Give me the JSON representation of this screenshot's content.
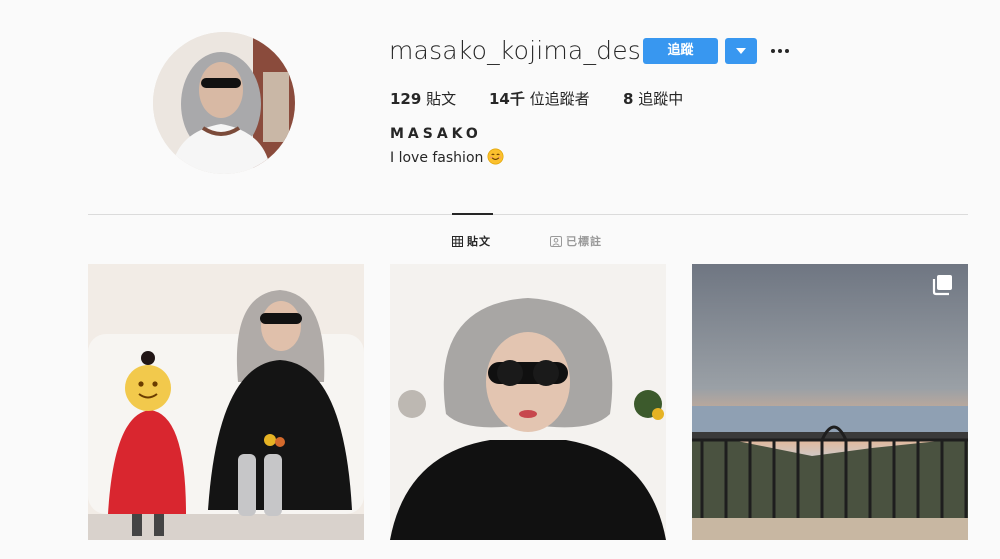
{
  "profile": {
    "username": "masako_kojima_desu",
    "follow_label": "追蹤",
    "stats": {
      "posts_count": "129",
      "posts_label": " 貼文",
      "followers_count": "14千",
      "followers_label": " 位追蹤者",
      "following_count": "8",
      "following_label": " 追蹤中"
    },
    "full_name": "MASAKO",
    "bio": "I love fashion"
  },
  "tabs": [
    {
      "label": "貼文",
      "icon": "grid-icon",
      "active": true
    },
    {
      "label": "已標註",
      "icon": "tagged-icon",
      "active": false
    }
  ],
  "posts": [
    {
      "icon": "photo-icon"
    },
    {
      "icon": "photo-icon"
    },
    {
      "icon": "multi-image-icon"
    }
  ],
  "colors": {
    "accent": "#3897f0",
    "background": "#fafafa",
    "text": "#262626",
    "muted": "#999999",
    "divider": "#dbdbdb"
  }
}
